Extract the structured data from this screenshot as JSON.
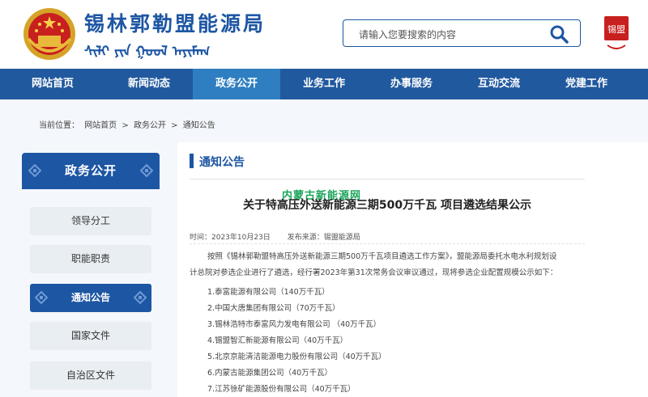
{
  "header": {
    "site_title": "锡林郭勒盟能源局",
    "mongol_script": "ᠰᠢᠯᠢ ᠶᠢᠨ ᠭᠣᠣᠯ ᠠᠶᠢᠮᠠᠭ",
    "search_placeholder": "请输入您要搜索的内容",
    "seal_text": "锡盟"
  },
  "nav": {
    "items": [
      "网站首页",
      "新闻动态",
      "政务公开",
      "业务工作",
      "办事服务",
      "互动交流",
      "党建工作"
    ],
    "active": "政务公开"
  },
  "breadcrumb": {
    "prefix": "当前位置：",
    "items": [
      "网站首页",
      ">",
      "政务公开",
      ">",
      "通知公告"
    ]
  },
  "sidebar": {
    "title": "政务公开",
    "items": [
      "领导分工",
      "职能职责",
      "通知公告",
      "国家文件",
      "自治区文件"
    ],
    "active": "通知公告"
  },
  "article": {
    "section_title": "通知公告",
    "watermark": "内蒙古新能源网",
    "title": "关于特高压外送新能源三期500万千瓦 项目遴选结果公示",
    "time": "时间：2023年10月23日",
    "source": "发布来源：锡盟能源局",
    "para1": "按照《锡林郭勒盟特高压外送新能源三期500万千瓦项目遴选工作方案》，盟能源局委托水电水利规划设",
    "para2": "计总院对参选企业进行了遴选，经行署2023年第31次常务会议审议通过，现将参选企业配置规模公示如下：",
    "list": [
      "1.泰富能源有限公司（140万千瓦）",
      "2.中国大唐集团有限公司（70万千瓦）",
      "3.锡林浩特市泰富风力发电有限公司 （40万千瓦）",
      "4.锡盟智汇新能源有限公司（40万千瓦）",
      "5.北京京能清洁能源电力股份有限公司（40万千瓦）",
      "6.内蒙古能源集团公司（40万千瓦）",
      "7.江苏徐矿能源股份有限公司（40万千瓦）"
    ]
  },
  "colors": {
    "brand_blue": "#1d56a3",
    "nav_active": "#2e7ec1",
    "watermark_green": "#19a55a"
  }
}
